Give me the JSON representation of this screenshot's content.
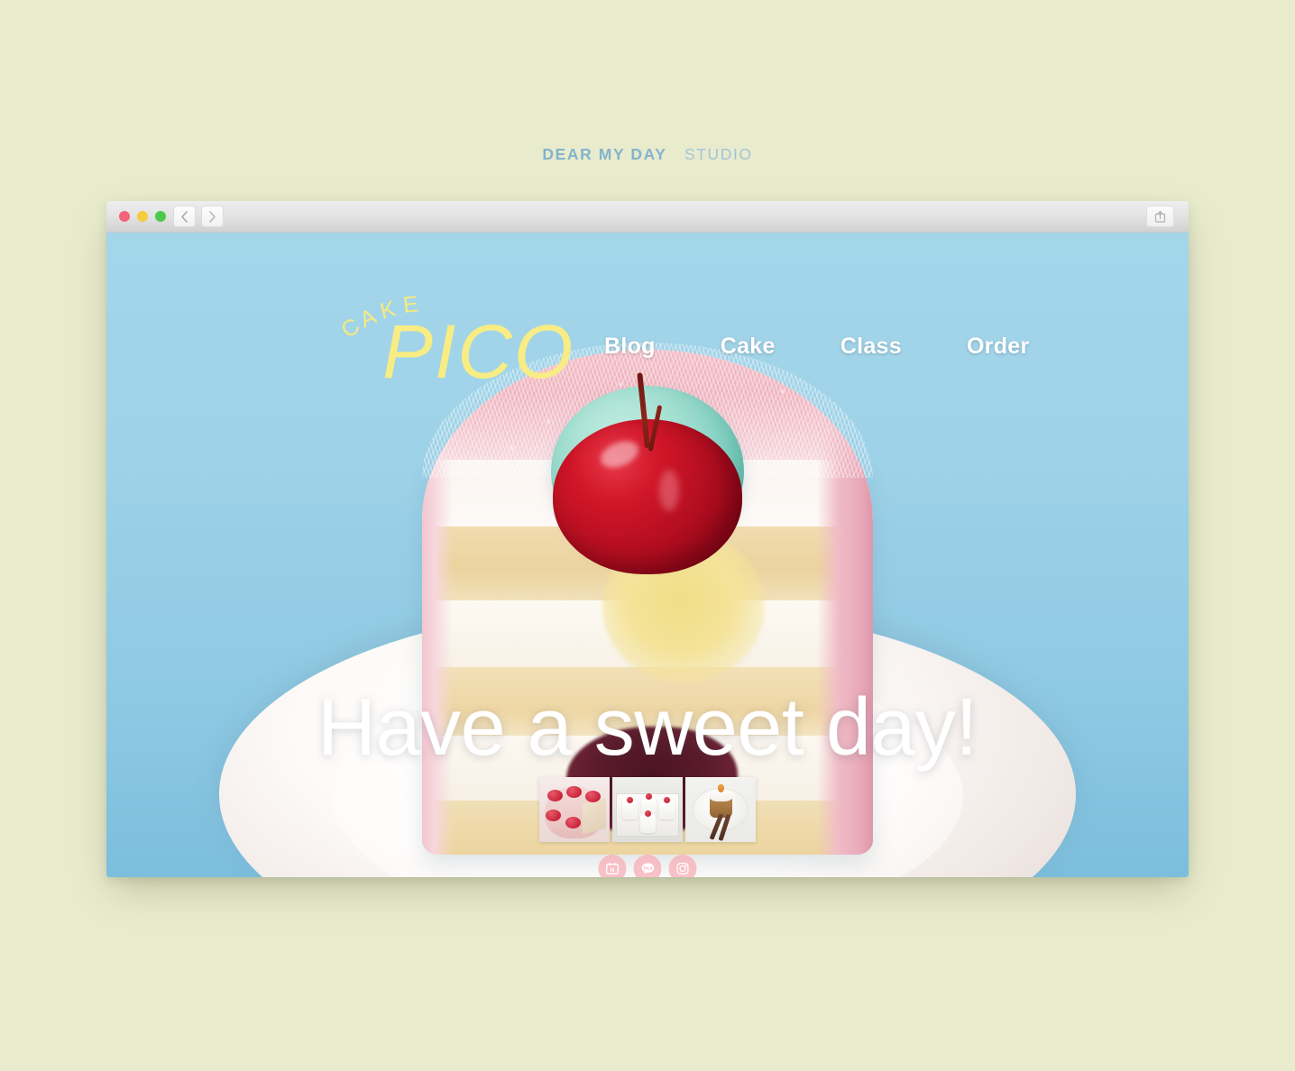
{
  "page": {
    "background_color": "#e8ebcc"
  },
  "studio_header": {
    "bold_part": "DEAR MY DAY",
    "light_part": "STUDIO",
    "color": "#8fb8cf"
  },
  "browser": {
    "traffic_lights": [
      {
        "name": "close",
        "color": "#f4647c"
      },
      {
        "name": "minimize",
        "color": "#f5cb3f"
      },
      {
        "name": "maximize",
        "color": "#4cc94c"
      }
    ],
    "back_button": "back-icon",
    "forward_button": "forward-icon",
    "share_button": "share-icon"
  },
  "site": {
    "logo": {
      "arc_letters": [
        "C",
        "A",
        "K",
        "E"
      ],
      "arc_word": "CAKE",
      "main_word": "PICO",
      "color": "#f8ec84"
    },
    "nav": [
      {
        "label": "Blog"
      },
      {
        "label": "Cake"
      },
      {
        "label": "Class"
      },
      {
        "label": "Order"
      }
    ],
    "headline": "Have a sweet day!",
    "hero_background_color": "#9dd3ea",
    "thumbnails": [
      {
        "name": "strawberry-cake-thumbnail"
      },
      {
        "name": "mini-cakes-thumbnail"
      },
      {
        "name": "carrot-cupcake-thumbnail"
      }
    ],
    "socials": [
      {
        "name": "naver-blog-icon",
        "label": "N"
      },
      {
        "name": "kakaotalk-icon",
        "label": "TALK"
      },
      {
        "name": "instagram-icon",
        "label": ""
      }
    ],
    "social_color": "#f8aab4"
  }
}
